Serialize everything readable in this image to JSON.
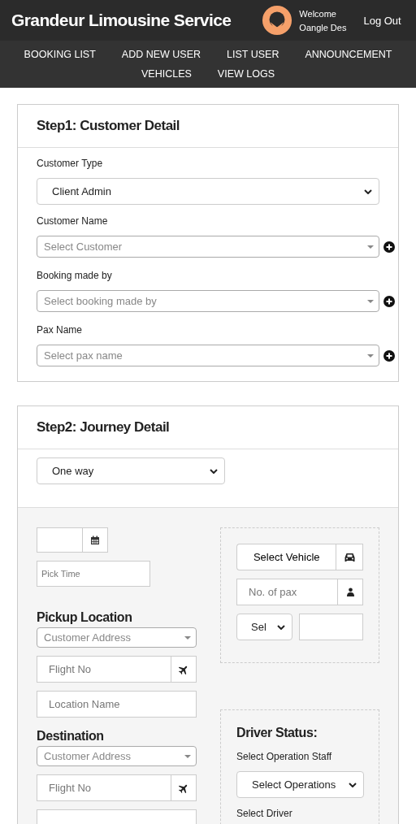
{
  "header": {
    "title": "Grandeur Limousine Service",
    "welcome": "Welcome",
    "user": "Oangle Des",
    "logout": "Log Out"
  },
  "nav": [
    "BOOKING LIST",
    "ADD NEW USER",
    "LIST USER",
    "ANNOUNCEMENT",
    "VEHICLES",
    "VIEW LOGS"
  ],
  "step1": {
    "title": "Step1: Customer Detail",
    "fields": [
      {
        "label": "Customer Type",
        "kind": "select",
        "value": "Client Admin"
      },
      {
        "label": "Customer Name",
        "kind": "combo",
        "placeholder": "Select Customer"
      },
      {
        "label": "Booking made by",
        "kind": "combo",
        "placeholder": "Select booking made by"
      },
      {
        "label": "Pax Name",
        "kind": "combo",
        "placeholder": "Select pax name"
      }
    ]
  },
  "step2": {
    "title": "Step2: Journey Detail",
    "trip_type": "One way",
    "pick_time": {
      "placeholder": "Pick Time"
    },
    "locations": [
      {
        "title": "Pickup Location",
        "address": "Customer Address",
        "flight": {
          "placeholder": "Flight No"
        },
        "location": {
          "placeholder": "Location Name"
        }
      },
      {
        "title": "Destination",
        "address": "Customer Address",
        "flight": {
          "placeholder": "Flight No"
        }
      }
    ],
    "vehicle": {
      "select": "Select Vehicle",
      "pax": {
        "placeholder": "No. of pax"
      },
      "unit": "Sel"
    },
    "driver_status": {
      "title": "Driver Status:",
      "staff_label": "Select Operation Staff",
      "staff_select": "Select Operations",
      "driver_label": "Select Driver"
    }
  }
}
